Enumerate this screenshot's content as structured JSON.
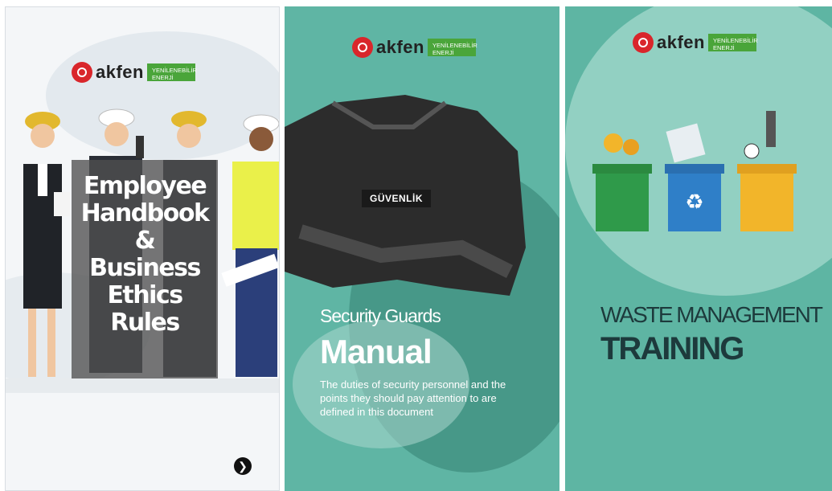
{
  "logo": {
    "brand": "akfen",
    "tagline": "YENİLENEBİLİR ENERJİ"
  },
  "panel1": {
    "title_lines": [
      "Employee",
      "Handbook",
      "&",
      "Business",
      "Ethics",
      "Rules"
    ],
    "next_icon": "chevron-right-icon",
    "colors": {
      "title_box": "#555555",
      "next_button": "#111111"
    }
  },
  "panel2": {
    "badge": "GÜVENLİK",
    "subtitle": "Security Guards",
    "title": "Manual",
    "description": "The duties of security personnel and the points they should pay attention to are defined in this document"
  },
  "panel3": {
    "title_line1": "WASTE MANAGEMENT",
    "title_line2": "TRAINING",
    "bins": [
      {
        "name": "organic",
        "color": "#2f9a4a"
      },
      {
        "name": "recycle",
        "color": "#2f7fc8"
      },
      {
        "name": "general",
        "color": "#f2b52a"
      }
    ]
  },
  "colors": {
    "brand_red": "#d9262b",
    "brand_green": "#4aa53a",
    "teal": "#5fb5a4"
  }
}
